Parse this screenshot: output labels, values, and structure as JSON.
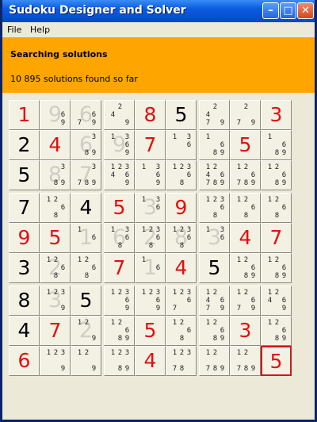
{
  "window": {
    "title": "Sudoku Designer and Solver",
    "minimize_icon": "minimize-icon",
    "maximize_icon": "maximize-icon",
    "close_icon": "close-icon"
  },
  "menu": {
    "items": [
      "File",
      "Help"
    ]
  },
  "banner": {
    "title": "Searching solutions",
    "status": "10 895 solutions found so far",
    "color": "#ffa500"
  },
  "colors": {
    "given": "#000000",
    "placed": "#e01010",
    "selected_border": "#d01818"
  },
  "board": [
    [
      {
        "v": "1",
        "t": "placed"
      },
      {
        "c": "9,6",
        "g": "9"
      },
      {
        "c": "7,6,9",
        "g": "6"
      },
      {
        "c": "2,4,9"
      },
      {
        "v": "8",
        "t": "placed"
      },
      {
        "v": "5",
        "t": "given"
      },
      {
        "c": "2,4,7,9"
      },
      {
        "c": "2,7,9"
      },
      {
        "v": "3",
        "t": "placed"
      }
    ],
    [
      {
        "v": "2",
        "t": "given"
      },
      {
        "v": "4",
        "t": "placed"
      },
      {
        "c": "3,8,9",
        "g": "6"
      },
      {
        "c": "1,3,6,9",
        "g": "9"
      },
      {
        "v": "7",
        "t": "placed"
      },
      {
        "c": "1,3,6"
      },
      {
        "c": "1,6,8,9"
      },
      {
        "v": "5",
        "t": "placed"
      },
      {
        "c": "1,6,8,9"
      }
    ],
    [
      {
        "v": "5",
        "t": "given"
      },
      {
        "c": "3,8,9",
        "g": "8"
      },
      {
        "c": "3,7,8,9",
        "g": "7"
      },
      {
        "c": "1,2,3,4,6,9"
      },
      {
        "c": "1,3,6,9"
      },
      {
        "c": "1,2,3,6,8"
      },
      {
        "c": "1,2,4,6,7,8,9"
      },
      {
        "c": "1,2,6,7,8,9"
      },
      {
        "c": "1,2,6,8,9"
      }
    ],
    [
      {
        "v": "7",
        "t": "given"
      },
      {
        "c": "1,2,6,8"
      },
      {
        "v": "4",
        "t": "given"
      },
      {
        "v": "5",
        "t": "placed"
      },
      {
        "c": "1,3,6",
        "g": "3"
      },
      {
        "v": "9",
        "t": "placed"
      },
      {
        "c": "1,2,3,6,8"
      },
      {
        "c": "1,2,6,8"
      },
      {
        "c": "1,2,6,8"
      }
    ],
    [
      {
        "v": "9",
        "t": "placed"
      },
      {
        "v": "5",
        "t": "placed"
      },
      {
        "c": "1,6",
        "g": "1"
      },
      {
        "c": "1,3,6,8",
        "g": "6"
      },
      {
        "c": "1,2,3,6,8",
        "g": "2"
      },
      {
        "c": "1,2,3,6,8",
        "g": "8"
      },
      {
        "c": "1,3,6",
        "g": "3"
      },
      {
        "v": "4",
        "t": "placed"
      },
      {
        "v": "7",
        "t": "placed"
      }
    ],
    [
      {
        "v": "3",
        "t": "given"
      },
      {
        "c": "1,2,6,8",
        "g": "2"
      },
      {
        "c": "1,2,6,8"
      },
      {
        "v": "7",
        "t": "placed"
      },
      {
        "c": "1,6",
        "g": "1"
      },
      {
        "v": "4",
        "t": "placed"
      },
      {
        "v": "5",
        "t": "given"
      },
      {
        "c": "1,2,6,8,9"
      },
      {
        "c": "1,2,6,8,9"
      }
    ],
    [
      {
        "v": "8",
        "t": "given"
      },
      {
        "c": "1,2,3,9",
        "g": "3"
      },
      {
        "v": "5",
        "t": "given"
      },
      {
        "c": "1,2,3,6,9"
      },
      {
        "c": "1,2,3,6,9"
      },
      {
        "c": "1,2,3,6,7"
      },
      {
        "c": "1,2,4,6,7,9"
      },
      {
        "c": "1,2,6,7,9"
      },
      {
        "c": "1,2,4,6,9"
      }
    ],
    [
      {
        "v": "4",
        "t": "given"
      },
      {
        "v": "7",
        "t": "placed"
      },
      {
        "c": "1,2,9",
        "g": "2"
      },
      {
        "c": "1,2,6,8,9"
      },
      {
        "v": "5",
        "t": "placed"
      },
      {
        "c": "1,2,6,8"
      },
      {
        "c": "1,2,6,8,9"
      },
      {
        "v": "3",
        "t": "placed"
      },
      {
        "c": "1,2,6,8,9"
      }
    ],
    [
      {
        "v": "6",
        "t": "placed"
      },
      {
        "c": "1,2,3,9"
      },
      {
        "c": "1,2,9"
      },
      {
        "c": "1,2,3,8,9"
      },
      {
        "v": "4",
        "t": "placed"
      },
      {
        "c": "1,2,3,7,8"
      },
      {
        "c": "1,2,7,8,9"
      },
      {
        "c": "1,2,7,8,9"
      },
      {
        "v": "5",
        "t": "placed",
        "sel": true
      }
    ]
  ]
}
